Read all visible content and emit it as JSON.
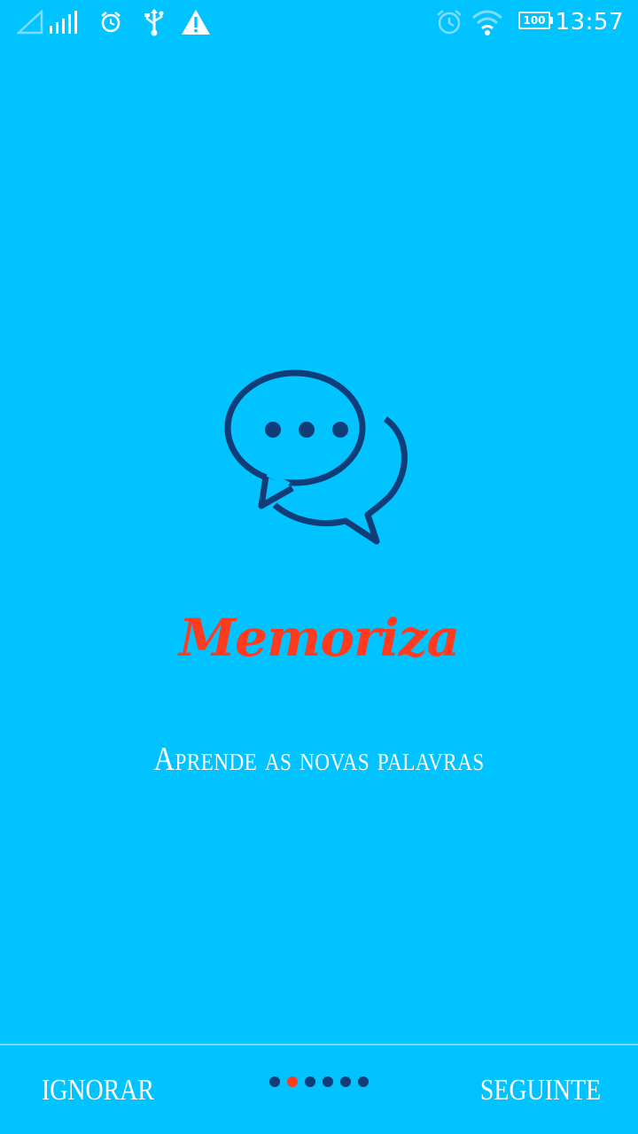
{
  "status_bar": {
    "time": "13:57",
    "battery": "100",
    "icons": [
      "signal-empty-icon",
      "signal-bars-icon",
      "alarm-icon",
      "usb-icon",
      "warning-icon",
      "alarm-clock-icon",
      "wifi-icon",
      "battery-icon"
    ]
  },
  "hero": {
    "icon": "chat-bubbles-icon",
    "title": "Memoriza",
    "subtitle": "Aprende as novas palavras"
  },
  "nav": {
    "skip_label": "IGNORAR",
    "next_label": "SEGUINTE",
    "page_dots": 6,
    "active_dot": 1
  },
  "colors": {
    "background": "#00c3ff",
    "accent": "#ff3b1f",
    "icon_dark": "#103d78"
  }
}
